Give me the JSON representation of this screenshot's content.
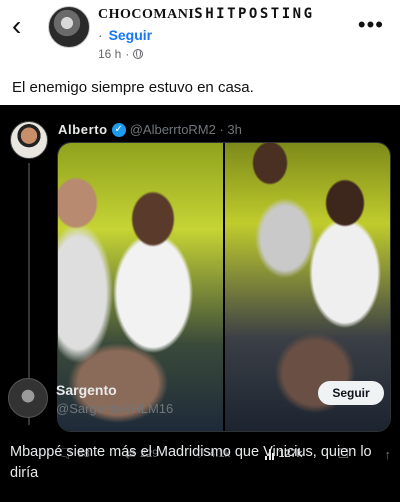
{
  "post": {
    "page_name_part1": "CHOCOMANI",
    "page_name_part2": "SHITPOSTING",
    "follow_label": "Seguir",
    "time": "16 h",
    "caption": "El enemigo siempre estuvo en casa."
  },
  "tweet": {
    "author_name": "Alberto",
    "handle_time": "@AlberrtoRM2 · 3h",
    "replies": "88",
    "retweets": "229",
    "likes": "4.1k",
    "views": "127k"
  },
  "reply": {
    "author_name": "Sargento",
    "handle": "@SargentoRHLM16",
    "follow_label": "Seguir",
    "text": "Mbappé siente más el Madridismo que Vinicius, quien lo diría"
  },
  "colors": {
    "fb_link": "#1877f2",
    "twitter_bg": "#000000",
    "twitter_blue": "#1d9bf0"
  }
}
